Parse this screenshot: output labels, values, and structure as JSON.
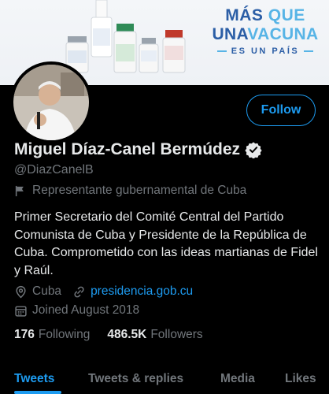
{
  "banner": {
    "slogan_line1_a": "MÁS",
    "slogan_line1_b": "QUE",
    "slogan_line2_a": "UNA",
    "slogan_line2_b": "VACUNA",
    "slogan_line3": "ES UN PAÍS"
  },
  "profile": {
    "name": "Miguel Díaz-Canel Bermúdez",
    "handle": "@DiazCanelB",
    "label": "Representante gubernamental de Cuba",
    "bio": "Primer Secretario del Comité Central del Partido Comunista de Cuba y Presidente de la República de Cuba. Comprometido con las ideas martianas de Fidel y Raúl.",
    "location": "Cuba",
    "website": "presidencia.gob.cu",
    "joined": "Joined August 2018",
    "following_count": "176",
    "following_label": "Following",
    "followers_count": "486.5K",
    "followers_label": "Followers"
  },
  "actions": {
    "follow_label": "Follow"
  },
  "tabs": [
    {
      "label": "Tweets"
    },
    {
      "label": "Tweets & replies"
    },
    {
      "label": "Media"
    },
    {
      "label": "Likes"
    }
  ],
  "icons": {
    "verified": "verified-badge-icon",
    "label": "flag-icon",
    "location": "location-pin-icon",
    "website": "link-icon",
    "joined": "calendar-icon"
  },
  "colors": {
    "accent": "#1d9bf0",
    "background": "#000000",
    "text": "#e7e9ea",
    "muted": "#71767b",
    "banner_blue": "#2b5ea6",
    "banner_light_blue": "#57b4e6"
  }
}
